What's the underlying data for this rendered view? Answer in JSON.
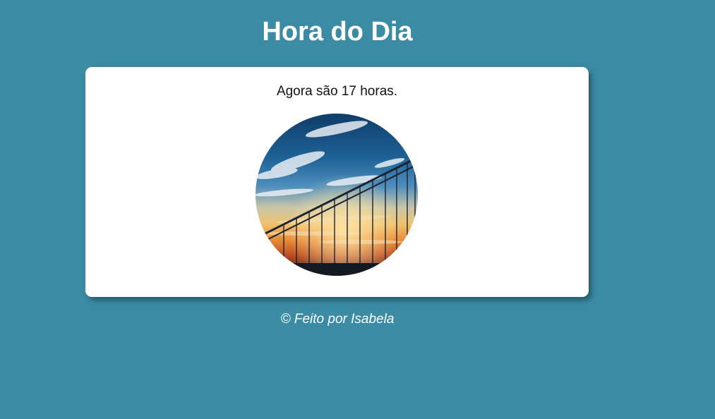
{
  "header": {
    "title": "Hora do Dia"
  },
  "main": {
    "message": "Agora são 17 horas.",
    "image": {
      "subject": "sunset-bridge-photo"
    }
  },
  "footer": {
    "text": "© Feito por Isabela"
  },
  "colors": {
    "background": "#3b8ba5",
    "card": "#ffffff",
    "title_text": "#ffffff",
    "body_text": "#111111"
  }
}
